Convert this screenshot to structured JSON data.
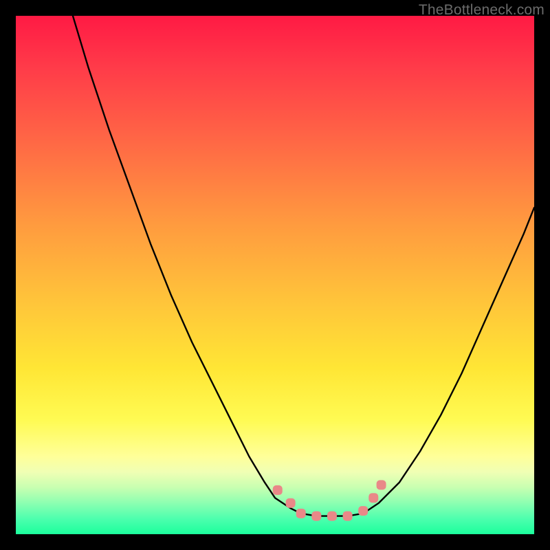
{
  "watermark": {
    "text": "TheBottleneck.com"
  },
  "colors": {
    "curve": "#000000",
    "marker_fill": "#e98888",
    "marker_stroke": "#bb5a5a"
  },
  "chart_data": {
    "type": "line",
    "title": "",
    "xlabel": "",
    "ylabel": "",
    "xlim": [
      0,
      100
    ],
    "ylim": [
      0,
      100
    ],
    "grid": false,
    "legend": false,
    "note": "V-shaped bottleneck curve on a red→green vertical gradient. No axis ticks or numeric labels are rendered in the image; x/y are normalised 0–100 estimates from pixel positions.",
    "series": [
      {
        "name": "left-branch",
        "x": [
          11,
          14,
          18,
          22,
          26,
          30,
          34,
          38,
          42,
          45,
          48,
          50,
          53,
          55
        ],
        "y": [
          100,
          90,
          78,
          67,
          56,
          46,
          37,
          29,
          21,
          15,
          10,
          7,
          5,
          4
        ]
      },
      {
        "name": "floor",
        "x": [
          55,
          58,
          61,
          64,
          67
        ],
        "y": [
          4,
          3.5,
          3.5,
          3.5,
          4
        ]
      },
      {
        "name": "right-branch",
        "x": [
          67,
          70,
          74,
          78,
          82,
          86,
          90,
          94,
          98,
          100
        ],
        "y": [
          4,
          6,
          10,
          16,
          23,
          31,
          40,
          49,
          58,
          63
        ]
      }
    ],
    "markers": {
      "name": "highlight-dots",
      "shape": "rounded-square",
      "x": [
        50.5,
        53,
        55,
        58,
        61,
        64,
        67,
        69,
        70.5
      ],
      "y": [
        8.5,
        6,
        4,
        3.5,
        3.5,
        3.5,
        4.5,
        7,
        9.5
      ]
    }
  }
}
